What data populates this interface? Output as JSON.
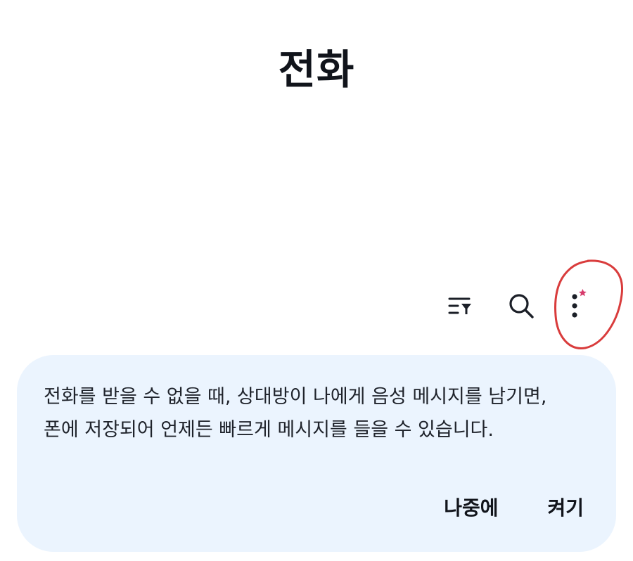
{
  "header": {
    "title": "전화"
  },
  "toolbar": {
    "filter_icon": "filter-list-icon",
    "search_icon": "search-icon",
    "more_icon": "more-vert-icon",
    "notification_dot_color": "#d63a6b",
    "annotation_color": "#d93c3c"
  },
  "voicemail_banner": {
    "message": "전화를 받을 수 없을 때, 상대방이 나에게 음성 메시지를 남기면, 폰에 저장되어 언제든 빠르게 메시지를 들을 수 있습니다.",
    "later_label": "나중에",
    "turn_on_label": "켜기",
    "background_color": "#ebf4fe"
  }
}
